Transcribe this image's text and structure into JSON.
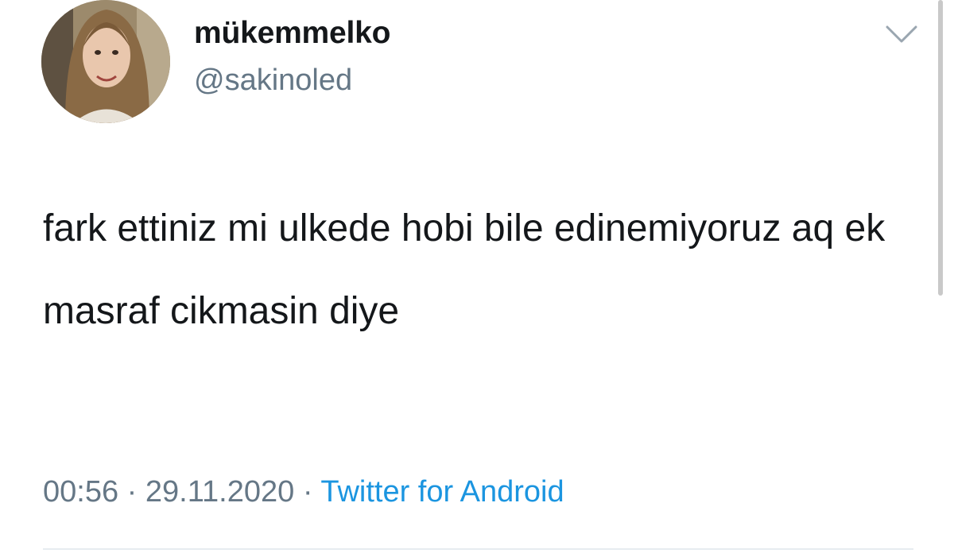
{
  "tweet": {
    "display_name": "mükemmelko",
    "handle": "@sakinoled",
    "text": "fark ettiniz mi ulkede hobi bile edinemiyoruz aq ek masraf cikmasin diye",
    "time": "00:56",
    "separator": "·",
    "date": "29.11.2020",
    "source": "Twitter for Android",
    "menu_icon": "chevron-down-icon",
    "avatar_icon": "avatar"
  },
  "colors": {
    "text": "#14171a",
    "secondary": "#657786",
    "link": "#1b95e0",
    "divider": "#e6ecf0"
  }
}
